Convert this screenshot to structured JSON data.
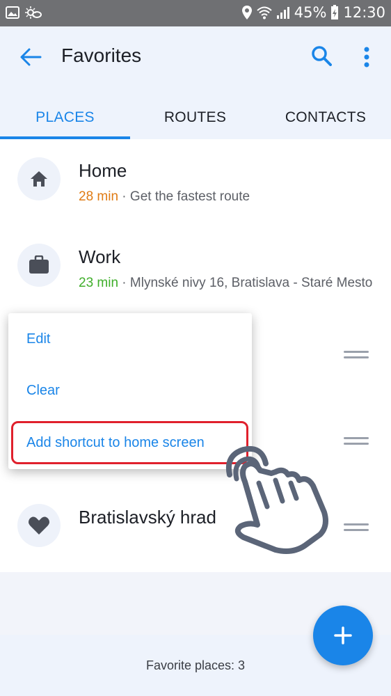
{
  "status_bar": {
    "battery": "45%",
    "time": "12:30",
    "icons": [
      "image-icon",
      "weather-icon",
      "location-icon",
      "wifi-icon",
      "signal-icon",
      "battery-icon"
    ]
  },
  "header": {
    "title": "Favorites",
    "icons": [
      "back-arrow-icon",
      "search-icon",
      "more-vert-icon"
    ]
  },
  "tabs": [
    {
      "label": "PLACES",
      "active": true
    },
    {
      "label": "ROUTES",
      "active": false
    },
    {
      "label": "CONTACTS",
      "active": false
    }
  ],
  "places": [
    {
      "name": "Home",
      "eta": "28 min",
      "sep": " · ",
      "detail": "Get the fastest route",
      "icon": "home-icon"
    },
    {
      "name": "Work",
      "eta": "23 min",
      "sep": " · ",
      "detail": "Mlynské nivy 16, Bratislava - Staré Mesto",
      "icon": "briefcase-icon"
    },
    {
      "name": "Bratislavský hrad",
      "icon": "heart-icon"
    }
  ],
  "context_menu": {
    "items": [
      "Edit",
      "Clear",
      "Add shortcut to home screen"
    ]
  },
  "footer": {
    "text": "Favorite places: 3"
  },
  "colors": {
    "accent": "#1a85e8",
    "eta_orange": "#e07b14",
    "eta_green": "#3fae2a",
    "highlight": "#e0202c"
  }
}
